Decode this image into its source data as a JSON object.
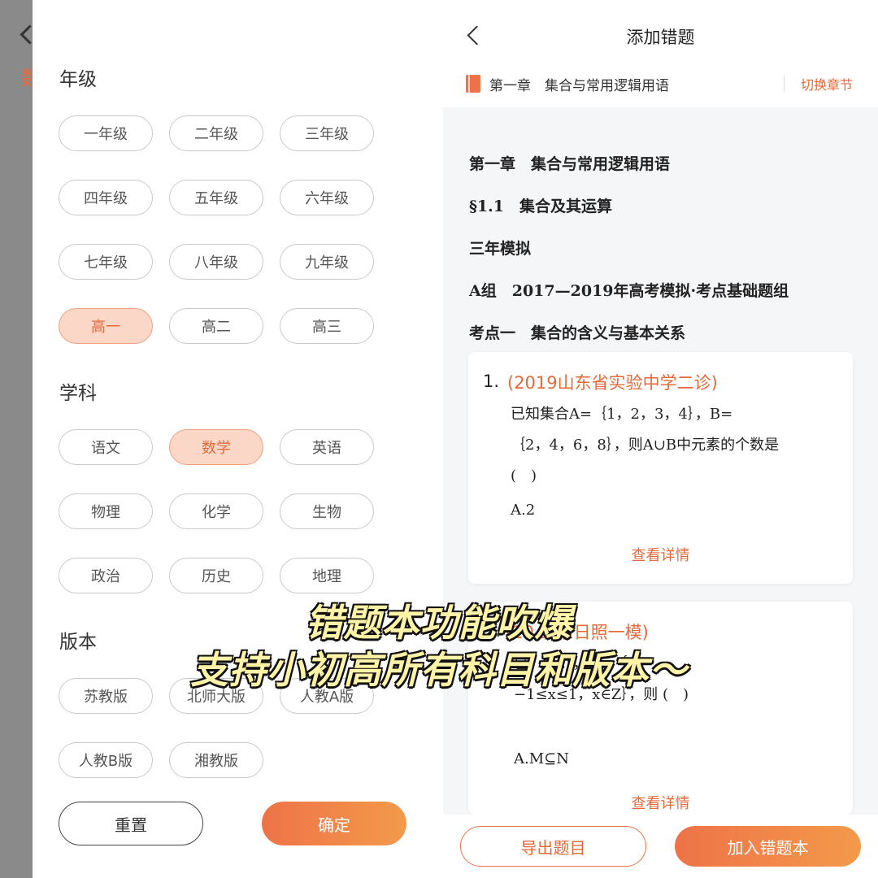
{
  "left_peek": {
    "text": "数"
  },
  "filter": {
    "grade": {
      "title": "年级",
      "options": [
        "一年级",
        "二年级",
        "三年级",
        "四年级",
        "五年级",
        "六年级",
        "七年级",
        "八年级",
        "九年级",
        "高一",
        "高二",
        "高三"
      ],
      "selected": "高一"
    },
    "subject": {
      "title": "学科",
      "options": [
        "语文",
        "数学",
        "英语",
        "物理",
        "化学",
        "生物",
        "政治",
        "历史",
        "地理"
      ],
      "selected": "数学"
    },
    "edition": {
      "title": "版本",
      "options": [
        "苏教版",
        "北师大版",
        "人教A版",
        "人教B版",
        "湘教版"
      ]
    },
    "reset_label": "重置",
    "confirm_label": "确定"
  },
  "add_screen": {
    "title": "添加错题",
    "chapter_label": "第一章　集合与常用逻辑用语",
    "switch_label": "切换章节",
    "headings": [
      "第一章　集合与常用逻辑用语",
      "§1.1　集合及其运算",
      "三年模拟",
      "A组　2017—2019年高考模拟·考点基础题组",
      "考点一　集合的含义与基本关系"
    ],
    "questions": [
      {
        "number": "1.",
        "source": "(2019山东省实验中学二诊)",
        "lines": [
          "已知集合A=｛1，2，3，4｝，B=",
          "｛2，4，6，8｝，则A∪B中元素的个数是",
          "(　)"
        ],
        "answer": "A.2",
        "detail_label": "查看详情"
      },
      {
        "number": "2.",
        "source": "(20  山东日照一模)",
        "lines": [
          "已      2｝，N=｛x|",
          "−1≤x≤1，x∈Z｝，则 (　)"
        ],
        "answer": "A.M⊆N",
        "detail_label": "查看详情"
      }
    ],
    "export_label": "导出题目",
    "add_label": "加入错题本"
  },
  "caption": {
    "line1": "错题本功能吹爆",
    "line2": "支持小初高所有科目和版本～"
  },
  "colors": {
    "accent": "#e46a3a",
    "accent_light": "#fbd7c8",
    "backdrop": "#8a8a8a"
  }
}
